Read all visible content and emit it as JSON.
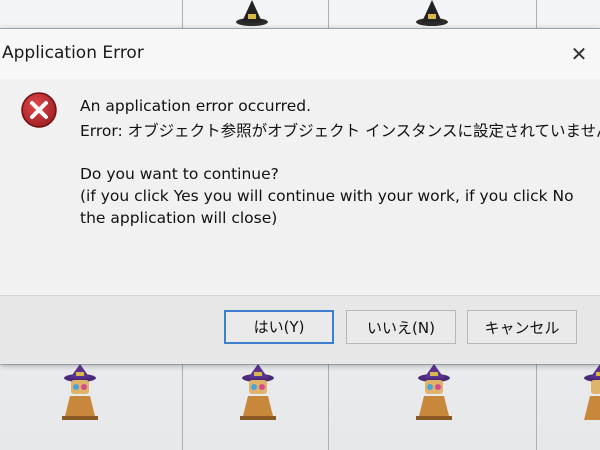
{
  "dialog": {
    "title": "Application Error",
    "close_symbol": "✕",
    "icon": "error-x-icon",
    "message": {
      "line1": "An application error occurred.",
      "line2": "Error: オブジェクト参照がオブジェクト インスタンスに設定されていません。",
      "line3": "Do you want to continue?",
      "line4": "(if you click Yes you will continue with your work, if you click No",
      "line5": "the application will close)"
    },
    "buttons": {
      "yes": "はい(Y)",
      "no": "いいえ(N)",
      "cancel": "キャンセル"
    }
  },
  "colors": {
    "error_icon_red": "#b3262a",
    "default_button_border": "#3d7fcf"
  }
}
